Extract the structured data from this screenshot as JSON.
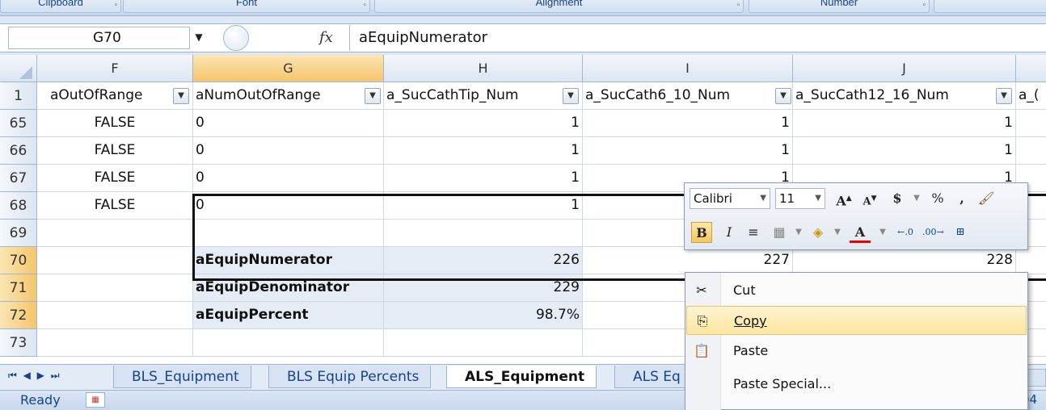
{
  "ribbon_groups": [
    {
      "label": "Clipboard"
    },
    {
      "label": "Font"
    },
    {
      "label": "Alignment"
    },
    {
      "label": "Number"
    }
  ],
  "formula_bar": {
    "name_box": "G70",
    "fx": "fx",
    "formula": "aEquipNumerator"
  },
  "columns": [
    "F",
    "G",
    "H",
    "I",
    "J"
  ],
  "header_row": {
    "row_num": "1",
    "cells": [
      "aOutOfRange",
      "aNumOutOfRange",
      "a_SucCathTip_Num",
      "a_SucCath6_10_Num",
      "a_SucCath12_16_Num",
      "a_("
    ]
  },
  "rows": [
    {
      "num": "65",
      "f": "FALSE",
      "g": "0",
      "h": "1",
      "i": "1",
      "j": "1"
    },
    {
      "num": "66",
      "f": "FALSE",
      "g": "0",
      "h": "1",
      "i": "1",
      "j": "1"
    },
    {
      "num": "67",
      "f": "FALSE",
      "g": "0",
      "h": "1",
      "i": "1",
      "j": "1"
    },
    {
      "num": "68",
      "f": "FALSE",
      "g": "0",
      "h": "1",
      "i": "",
      "j": ""
    },
    {
      "num": "69",
      "f": "",
      "g": "",
      "h": "",
      "i": "",
      "j": ""
    },
    {
      "num": "70",
      "f": "",
      "g": "aEquipNumerator",
      "h": "226",
      "i": "227",
      "j": "228"
    },
    {
      "num": "71",
      "f": "",
      "g": "aEquipDenominator",
      "h": "229",
      "i": "",
      "j": ""
    },
    {
      "num": "72",
      "f": "",
      "g": "aEquipPercent",
      "h": "98.7%",
      "i": "",
      "j": ""
    },
    {
      "num": "73",
      "f": "",
      "g": "",
      "h": "",
      "i": "",
      "j": ""
    }
  ],
  "sheet_tabs": [
    "BLS_Equipment",
    "BLS Equip Percents",
    "ALS_Equipment",
    "ALS Eq"
  ],
  "active_tab": "ALS_Equipment",
  "status": {
    "text": "Ready",
    "right": "04"
  },
  "mini_toolbar": {
    "font": "Calibri",
    "size": "11",
    "buttons_row1": [
      "A",
      "A",
      "$",
      "%",
      ","
    ],
    "buttons_row2": [
      "B",
      "I"
    ]
  },
  "context_menu": {
    "items": [
      {
        "label": "Cut",
        "icon": "scissors-icon"
      },
      {
        "label": "Copy",
        "icon": "copy-icon"
      },
      {
        "label": "Paste",
        "icon": "paste-icon"
      },
      {
        "label": "Paste Special...",
        "icon": ""
      }
    ]
  },
  "colors": {
    "selected_header": "#f5c56a",
    "accent": "#15428b"
  }
}
